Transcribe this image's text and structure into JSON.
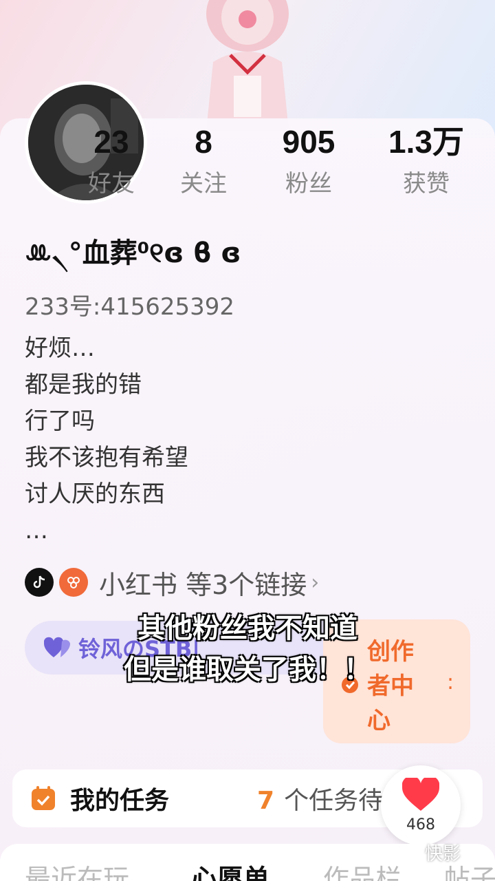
{
  "profile": {
    "nickname": "ꔛ৲°血葬⁰୧ɞ ϐ ɞ",
    "uid": "233号:415625392",
    "bio_lines": [
      "好烦…",
      "都是我的错",
      "行了吗",
      "我不该抱有希望",
      "讨人厌的东西",
      "…"
    ]
  },
  "stats": [
    {
      "value": "23",
      "label": "好友"
    },
    {
      "value": "8",
      "label": "关注"
    },
    {
      "value": "905",
      "label": "粉丝"
    },
    {
      "value": "1.3万",
      "label": "获赞"
    }
  ],
  "links": {
    "text": "小红书 等3个链接"
  },
  "chip": {
    "text": "铃风のSTB|"
  },
  "creator": {
    "label": "创作者中心"
  },
  "subtitle": {
    "line1": "其他粉丝我不知道",
    "line2": "但是谁取关了我！！"
  },
  "tasks": {
    "title": "我的任务",
    "count": "7",
    "suffix": "个任务待"
  },
  "like": {
    "count": "468"
  },
  "tabs": [
    "最近在玩",
    "心愿单",
    "作品栏",
    "帖子"
  ],
  "watermark": "快影",
  "colors": {
    "accent_orange": "#f0822c",
    "chip_purple": "#6f62d8",
    "like_red": "#ff3b4a"
  }
}
